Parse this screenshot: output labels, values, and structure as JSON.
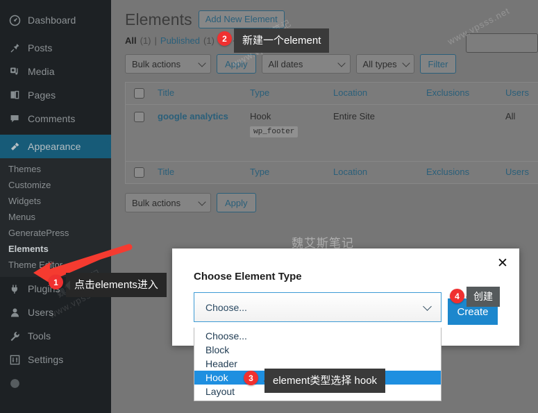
{
  "sidebar": {
    "items": [
      {
        "label": "Dashboard",
        "icon": "dashboard-icon",
        "current": false
      },
      {
        "label": "Posts",
        "icon": "pin-icon",
        "current": false
      },
      {
        "label": "Media",
        "icon": "media-icon",
        "current": false
      },
      {
        "label": "Pages",
        "icon": "pages-icon",
        "current": false
      },
      {
        "label": "Comments",
        "icon": "comments-icon",
        "current": false
      },
      {
        "label": "Appearance",
        "icon": "brush-icon",
        "current": true
      },
      {
        "label": "Plugins",
        "icon": "plug-icon",
        "current": false
      },
      {
        "label": "Users",
        "icon": "user-icon",
        "current": false
      },
      {
        "label": "Tools",
        "icon": "wrench-icon",
        "current": false
      },
      {
        "label": "Settings",
        "icon": "settings-icon",
        "current": false
      }
    ],
    "submenu": [
      {
        "label": "Themes",
        "active": false
      },
      {
        "label": "Customize",
        "active": false
      },
      {
        "label": "Widgets",
        "active": false
      },
      {
        "label": "Menus",
        "active": false
      },
      {
        "label": "GeneratePress",
        "active": false
      },
      {
        "label": "Elements",
        "active": true
      },
      {
        "label": "Theme Editor",
        "active": false
      }
    ]
  },
  "header": {
    "title": "Elements",
    "add_new_label": "Add New Element"
  },
  "views": {
    "all_label": "All",
    "all_count": "(1)",
    "separator": "|",
    "published_label": "Published",
    "published_count": "(1)"
  },
  "filters": {
    "bulk_actions": "Bulk actions",
    "apply": "Apply",
    "all_dates": "All dates",
    "all_types": "All types",
    "filter": "Filter",
    "search_value": ""
  },
  "table": {
    "columns": [
      "Title",
      "Type",
      "Location",
      "Exclusions",
      "Users"
    ],
    "rows": [
      {
        "title": "google analytics",
        "type": "Hook",
        "hook_code": "wp_footer",
        "location": "Entire Site",
        "exclusions": "",
        "users": "All"
      }
    ],
    "footer_columns": [
      "Title",
      "Type",
      "Location",
      "Exclusions",
      "Users"
    ]
  },
  "bottom_actions": {
    "bulk_actions": "Bulk actions",
    "apply": "Apply"
  },
  "modal": {
    "title": "Choose Element Type",
    "close_icon": "close-icon",
    "select_value": "Choose...",
    "options": [
      {
        "label": "Choose...",
        "selected": false
      },
      {
        "label": "Block",
        "selected": false
      },
      {
        "label": "Header",
        "selected": false
      },
      {
        "label": "Hook",
        "selected": true
      },
      {
        "label": "Layout",
        "selected": false
      }
    ],
    "create_label": "Create"
  },
  "callouts": [
    {
      "number": "1",
      "text": "点击elements进入"
    },
    {
      "number": "2",
      "text": "新建一个element"
    },
    {
      "number": "3",
      "text": "element类型选择 hook"
    },
    {
      "number": "4",
      "text": "创建"
    }
  ],
  "watermark": {
    "cn": "魏艾斯笔记",
    "url": "www.vpsss.net"
  },
  "colors": {
    "wp_blue": "#2a5f7a",
    "accent_blue": "#1c87cd",
    "sidebar_bg": "#1d2124",
    "current_bg": "#175b78",
    "badge_red": "#f03030"
  }
}
